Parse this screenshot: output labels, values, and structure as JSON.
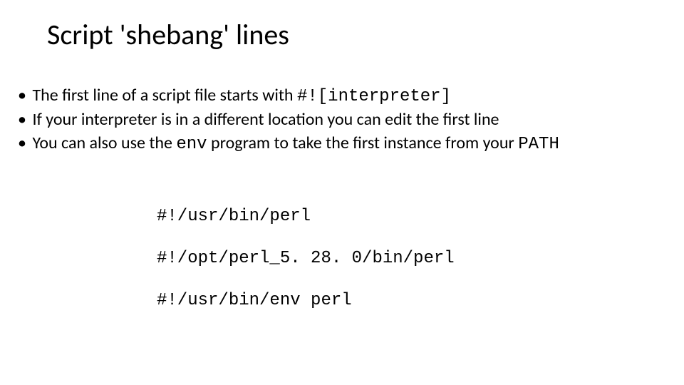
{
  "title": "Script 'shebang' lines",
  "bullets": [
    {
      "dot": "•",
      "pre": "The first line of a script file starts with ",
      "code": "#![interpreter]",
      "post": ""
    },
    {
      "dot": "•",
      "pre": "If your interpreter is in a different location you can edit the first line",
      "code": "",
      "post": ""
    },
    {
      "dot": "•",
      "pre": "You can also use the ",
      "code": "env",
      "post": " program to take the first instance from your ",
      "code2": "PATH"
    }
  ],
  "examples": [
    "#!/usr/bin/perl",
    "#!/opt/perl_5. 28. 0/bin/perl",
    "#!/usr/bin/env perl"
  ]
}
